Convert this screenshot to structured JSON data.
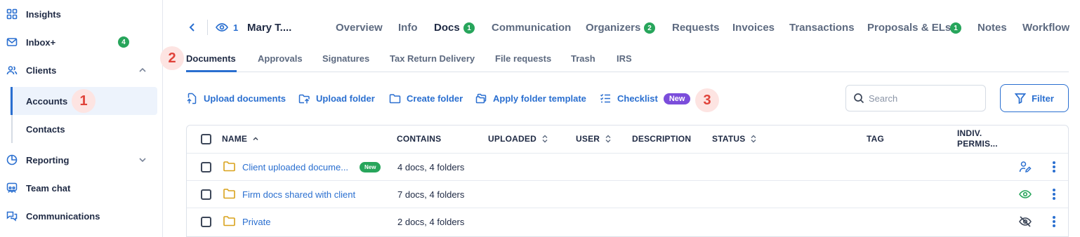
{
  "sidebar": {
    "items": [
      {
        "label": "Insights",
        "icon": "grid-icon"
      },
      {
        "label": "Inbox+",
        "icon": "mail-icon",
        "badge": "4"
      },
      {
        "label": "Clients",
        "icon": "users-icon",
        "expanded": true
      },
      {
        "label": "Reporting",
        "icon": "pie-chart-icon",
        "expanded": false
      },
      {
        "label": "Team chat",
        "icon": "team-chat-icon"
      },
      {
        "label": "Communications",
        "icon": "chat-bubbles-icon"
      }
    ],
    "subitems": [
      {
        "label": "Accounts",
        "active": true
      },
      {
        "label": "Contacts"
      }
    ]
  },
  "callouts": {
    "c1": "1",
    "c2": "2",
    "c3": "3"
  },
  "header": {
    "view_count": "1",
    "client_name": "Mary T....",
    "tabs": [
      {
        "label": "Overview"
      },
      {
        "label": "Info"
      },
      {
        "label": "Docs",
        "badge": "1",
        "active": true
      },
      {
        "label": "Communication"
      },
      {
        "label": "Organizers",
        "badge": "2"
      },
      {
        "label": "Requests"
      },
      {
        "label": "Invoices"
      },
      {
        "label": "Transactions"
      },
      {
        "label": "Proposals & ELs",
        "badge": "1"
      },
      {
        "label": "Notes"
      },
      {
        "label": "Workflow"
      }
    ]
  },
  "subtabs": [
    {
      "label": "Documents",
      "active": true
    },
    {
      "label": "Approvals"
    },
    {
      "label": "Signatures"
    },
    {
      "label": "Tax Return Delivery"
    },
    {
      "label": "File requests"
    },
    {
      "label": "Trash"
    },
    {
      "label": "IRS"
    }
  ],
  "actions": {
    "upload_documents": "Upload documents",
    "upload_folder": "Upload folder",
    "create_folder": "Create folder",
    "apply_folder_template": "Apply folder template",
    "checklist": "Checklist",
    "checklist_badge": "New"
  },
  "search": {
    "placeholder": "Search",
    "value": ""
  },
  "filter_label": "Filter",
  "table": {
    "columns": {
      "name": "NAME",
      "contains": "CONTAINS",
      "uploaded": "UPLOADED",
      "user": "USER",
      "description": "DESCRIPTION",
      "status": "STATUS",
      "tag": "TAG",
      "indiv_perm_1": "INDIV.",
      "indiv_perm_2": "PERMIS..."
    },
    "rows": [
      {
        "name": "Client uploaded docume...",
        "badge": "New",
        "contains": "4 docs, 4 folders",
        "permission_icon": "user-edit-icon"
      },
      {
        "name": "Firm docs shared with client",
        "contains": "7 docs, 4 folders",
        "permission_icon": "eye-icon"
      },
      {
        "name": "Private",
        "contains": "2 docs, 4 folders",
        "permission_icon": "eye-off-icon"
      }
    ]
  },
  "colors": {
    "accent": "#2a6fd0",
    "success": "#27a55b",
    "new_badge": "#7b4ddb",
    "callout": "#e0433a",
    "folder": "#d9a21b"
  }
}
